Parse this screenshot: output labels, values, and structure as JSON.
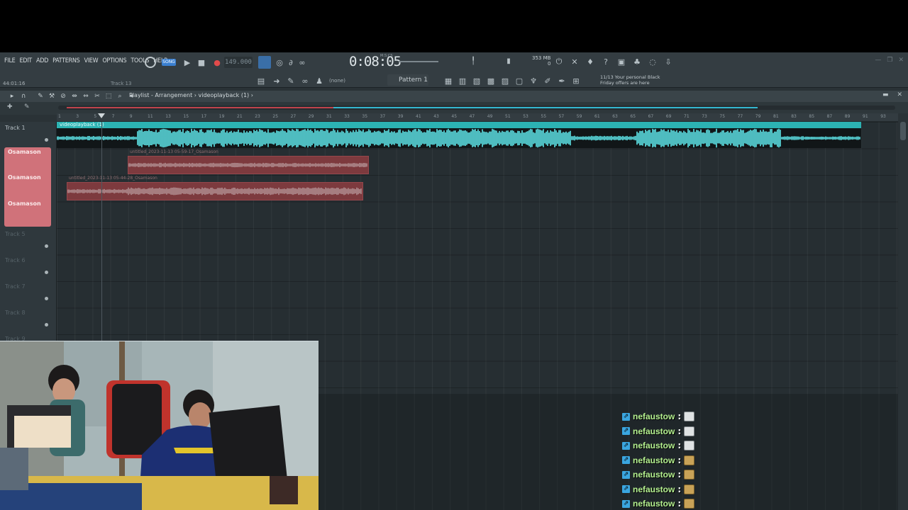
{
  "menu": {
    "items": [
      "FILE",
      "EDIT",
      "ADD",
      "PATTERNS",
      "VIEW",
      "OPTIONS",
      "TOOLS",
      "HELP"
    ],
    "hint_time": "44:01:16",
    "hint_track": "Track 13"
  },
  "transport": {
    "song_mode": "SONG",
    "tempo": "149.000",
    "time": "0:08:05",
    "time_sub": "M:S:CS",
    "memory_mb": "353 MB",
    "memory_sub": "0"
  },
  "toolbar2": {
    "snap": "(none)",
    "pattern": "Pattern 1",
    "news_line1": "11/13  Your personal Black",
    "news_line2": "Friday offers are here"
  },
  "playlist": {
    "path": "Playlist - Arrangement › videoplayback (1) ›",
    "ruler": [
      "1",
      "3",
      "5",
      "7",
      "9",
      "11",
      "13",
      "15",
      "17",
      "19",
      "21",
      "23",
      "25",
      "27",
      "29",
      "31",
      "33",
      "35",
      "37",
      "39",
      "41",
      "43",
      "45",
      "47",
      "49",
      "51",
      "53",
      "55",
      "57",
      "59",
      "61",
      "63",
      "65",
      "67",
      "69",
      "71",
      "73",
      "75",
      "77",
      "79",
      "81",
      "83",
      "85",
      "87",
      "89",
      "91",
      "93"
    ],
    "tracks": [
      "Track 1",
      "Track 5",
      "Track 6",
      "Track 7",
      "Track 8",
      "Track 9"
    ],
    "pink_tracks": [
      "Osamason",
      "Osamason",
      "Osamason"
    ],
    "clips": {
      "main": "videoplayback (1)",
      "red1": "untitled_2023-11-13 05-59-17_Osamason",
      "red2": "untitled_2023-11-13 05-44-28_Osamason"
    }
  },
  "chat": [
    {
      "user": "nefaustow",
      "emote": "e1"
    },
    {
      "user": "nefaustow",
      "emote": "e1"
    },
    {
      "user": "nefaustow",
      "emote": "e1"
    },
    {
      "user": "nefaustow",
      "emote": "e2"
    },
    {
      "user": "nefaustow",
      "emote": "e2"
    },
    {
      "user": "nefaustow",
      "emote": "e2"
    },
    {
      "user": "nefaustow",
      "emote": "e2"
    }
  ],
  "colors": {
    "audio_clip": "#2cb3b3",
    "waveform": "#5fe7ea",
    "track_group": "#d0727a",
    "chat_user": "#b4f08f"
  }
}
